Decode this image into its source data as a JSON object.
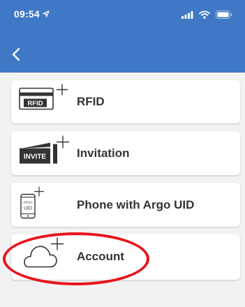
{
  "status_bar": {
    "time": "09:54",
    "location_icon": "location-arrow-icon",
    "signal_icon": "signal-icon",
    "wifi_icon": "wifi-icon",
    "battery_icon": "battery-icon"
  },
  "header": {
    "back_icon": "chevron-left-icon",
    "color": "#3f78c4"
  },
  "options": [
    {
      "label": "RFID",
      "icon": "rfid-card-add-icon",
      "icon_text": "RFID"
    },
    {
      "label": "Invitation",
      "icon": "invitation-add-icon",
      "icon_text": "INVITE"
    },
    {
      "label": "Phone with Argo UID",
      "icon": "phone-uid-add-icon",
      "icon_text_top": "ARGO",
      "icon_text_bottom": "UID"
    },
    {
      "label": "Account",
      "icon": "cloud-account-add-icon"
    }
  ],
  "annotation": {
    "color": "#e8141c",
    "target": "Account"
  }
}
